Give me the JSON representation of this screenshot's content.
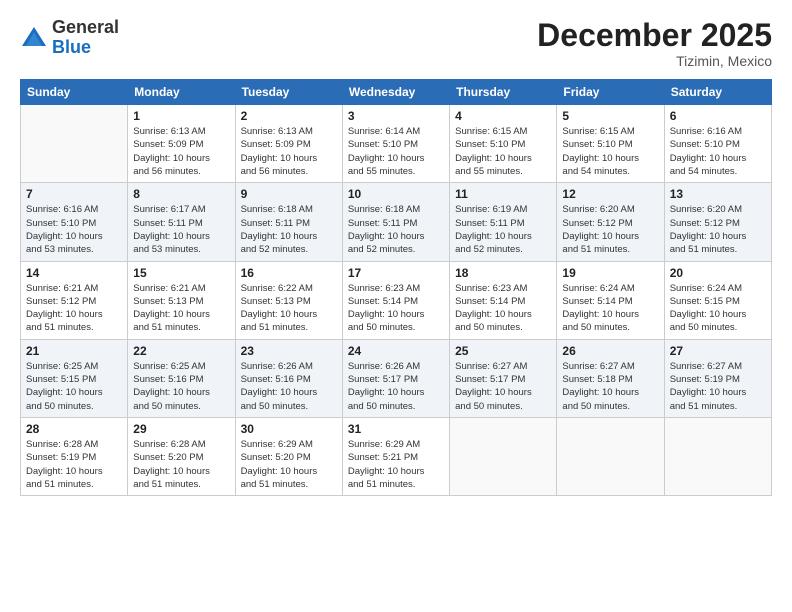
{
  "logo": {
    "general": "General",
    "blue": "Blue"
  },
  "header": {
    "month_year": "December 2025",
    "location": "Tizimin, Mexico"
  },
  "weekdays": [
    "Sunday",
    "Monday",
    "Tuesday",
    "Wednesday",
    "Thursday",
    "Friday",
    "Saturday"
  ],
  "weeks": [
    [
      {
        "day": "",
        "info": ""
      },
      {
        "day": "1",
        "info": "Sunrise: 6:13 AM\nSunset: 5:09 PM\nDaylight: 10 hours\nand 56 minutes."
      },
      {
        "day": "2",
        "info": "Sunrise: 6:13 AM\nSunset: 5:09 PM\nDaylight: 10 hours\nand 56 minutes."
      },
      {
        "day": "3",
        "info": "Sunrise: 6:14 AM\nSunset: 5:10 PM\nDaylight: 10 hours\nand 55 minutes."
      },
      {
        "day": "4",
        "info": "Sunrise: 6:15 AM\nSunset: 5:10 PM\nDaylight: 10 hours\nand 55 minutes."
      },
      {
        "day": "5",
        "info": "Sunrise: 6:15 AM\nSunset: 5:10 PM\nDaylight: 10 hours\nand 54 minutes."
      },
      {
        "day": "6",
        "info": "Sunrise: 6:16 AM\nSunset: 5:10 PM\nDaylight: 10 hours\nand 54 minutes."
      }
    ],
    [
      {
        "day": "7",
        "info": "Sunrise: 6:16 AM\nSunset: 5:10 PM\nDaylight: 10 hours\nand 53 minutes."
      },
      {
        "day": "8",
        "info": "Sunrise: 6:17 AM\nSunset: 5:11 PM\nDaylight: 10 hours\nand 53 minutes."
      },
      {
        "day": "9",
        "info": "Sunrise: 6:18 AM\nSunset: 5:11 PM\nDaylight: 10 hours\nand 52 minutes."
      },
      {
        "day": "10",
        "info": "Sunrise: 6:18 AM\nSunset: 5:11 PM\nDaylight: 10 hours\nand 52 minutes."
      },
      {
        "day": "11",
        "info": "Sunrise: 6:19 AM\nSunset: 5:11 PM\nDaylight: 10 hours\nand 52 minutes."
      },
      {
        "day": "12",
        "info": "Sunrise: 6:20 AM\nSunset: 5:12 PM\nDaylight: 10 hours\nand 51 minutes."
      },
      {
        "day": "13",
        "info": "Sunrise: 6:20 AM\nSunset: 5:12 PM\nDaylight: 10 hours\nand 51 minutes."
      }
    ],
    [
      {
        "day": "14",
        "info": "Sunrise: 6:21 AM\nSunset: 5:12 PM\nDaylight: 10 hours\nand 51 minutes."
      },
      {
        "day": "15",
        "info": "Sunrise: 6:21 AM\nSunset: 5:13 PM\nDaylight: 10 hours\nand 51 minutes."
      },
      {
        "day": "16",
        "info": "Sunrise: 6:22 AM\nSunset: 5:13 PM\nDaylight: 10 hours\nand 51 minutes."
      },
      {
        "day": "17",
        "info": "Sunrise: 6:23 AM\nSunset: 5:14 PM\nDaylight: 10 hours\nand 50 minutes."
      },
      {
        "day": "18",
        "info": "Sunrise: 6:23 AM\nSunset: 5:14 PM\nDaylight: 10 hours\nand 50 minutes."
      },
      {
        "day": "19",
        "info": "Sunrise: 6:24 AM\nSunset: 5:14 PM\nDaylight: 10 hours\nand 50 minutes."
      },
      {
        "day": "20",
        "info": "Sunrise: 6:24 AM\nSunset: 5:15 PM\nDaylight: 10 hours\nand 50 minutes."
      }
    ],
    [
      {
        "day": "21",
        "info": "Sunrise: 6:25 AM\nSunset: 5:15 PM\nDaylight: 10 hours\nand 50 minutes."
      },
      {
        "day": "22",
        "info": "Sunrise: 6:25 AM\nSunset: 5:16 PM\nDaylight: 10 hours\nand 50 minutes."
      },
      {
        "day": "23",
        "info": "Sunrise: 6:26 AM\nSunset: 5:16 PM\nDaylight: 10 hours\nand 50 minutes."
      },
      {
        "day": "24",
        "info": "Sunrise: 6:26 AM\nSunset: 5:17 PM\nDaylight: 10 hours\nand 50 minutes."
      },
      {
        "day": "25",
        "info": "Sunrise: 6:27 AM\nSunset: 5:17 PM\nDaylight: 10 hours\nand 50 minutes."
      },
      {
        "day": "26",
        "info": "Sunrise: 6:27 AM\nSunset: 5:18 PM\nDaylight: 10 hours\nand 50 minutes."
      },
      {
        "day": "27",
        "info": "Sunrise: 6:27 AM\nSunset: 5:19 PM\nDaylight: 10 hours\nand 51 minutes."
      }
    ],
    [
      {
        "day": "28",
        "info": "Sunrise: 6:28 AM\nSunset: 5:19 PM\nDaylight: 10 hours\nand 51 minutes."
      },
      {
        "day": "29",
        "info": "Sunrise: 6:28 AM\nSunset: 5:20 PM\nDaylight: 10 hours\nand 51 minutes."
      },
      {
        "day": "30",
        "info": "Sunrise: 6:29 AM\nSunset: 5:20 PM\nDaylight: 10 hours\nand 51 minutes."
      },
      {
        "day": "31",
        "info": "Sunrise: 6:29 AM\nSunset: 5:21 PM\nDaylight: 10 hours\nand 51 minutes."
      },
      {
        "day": "",
        "info": ""
      },
      {
        "day": "",
        "info": ""
      },
      {
        "day": "",
        "info": ""
      }
    ]
  ]
}
